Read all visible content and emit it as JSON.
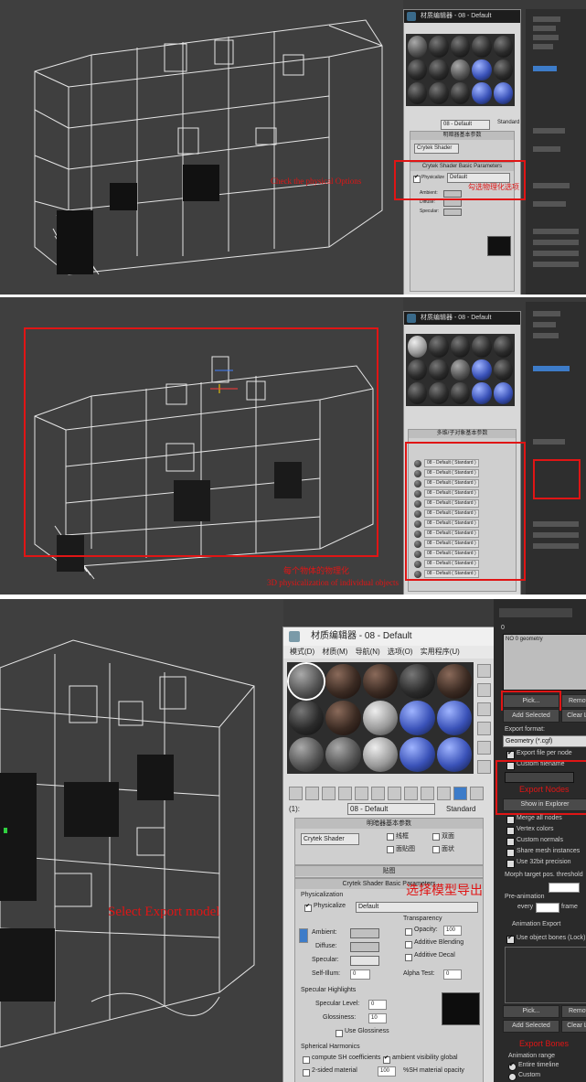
{
  "panel1": {
    "editor_title": "材质编辑器 - 08 - Default",
    "material_slot": "08 - Default",
    "shader_type": "Standard",
    "shader": "Crytek Shader",
    "rollout_basic": "明暗器基本参数",
    "rollout_crytek": "Crytek Shader Basic Parameters",
    "physicalize_label": "Physicalize",
    "physicalize_value": "Default",
    "ambient_label": "Ambient:",
    "diffuse_label": "Diffuse:",
    "specular_label": "Specular:",
    "annotation_en": "Check the physical Options",
    "annotation_cn": "勾选物理化选项"
  },
  "panel2": {
    "editor_title": "材质编辑器 - 08 - Default",
    "multi_header": "多维/子对象基本参数",
    "list_count": 12,
    "list_item_label": "08 - Default ( Standard )",
    "annotation_cn": "每个物体的物理化",
    "annotation_en": "3D physicalization of individual objects"
  },
  "panel3": {
    "editor_title": "材质编辑器 - 08 - Default",
    "menu": [
      "模式(D)",
      "材质(M)",
      "导航(N)",
      "选项(O)",
      "实用程序(U)"
    ],
    "slot_number": "(1):",
    "material_slot": "08 - Default",
    "shader_type": "Standard",
    "rollout_basic": "明暗器基本参数",
    "shader": "Crytek Shader",
    "checks": [
      "线框",
      "双面",
      "面贴图",
      "面状"
    ],
    "rollout_maps": "贴图",
    "rollout_crytek": "Crytek Shader Basic Parameters",
    "physicalization_group": "Physicalization",
    "physicalize_label": "Physicalize",
    "physicalize_value": "Default",
    "ambient_label": "Ambient:",
    "diffuse_label": "Diffuse:",
    "specular_label": "Specular:",
    "self_illum_label": "Self-Illum:",
    "self_illum_value": "0",
    "transparency_group": "Transparency",
    "opacity_label": "Opacity:",
    "opacity_value": "100",
    "additive_blending": "Additive Blending",
    "additive_decal": "Additive Decal",
    "alpha_test_label": "Alpha Test:",
    "alpha_test_value": "0",
    "specular_group": "Specular Highlights",
    "spec_level_label": "Specular Level:",
    "spec_level_value": "0",
    "glossiness_label": "Glossiness:",
    "glossiness_value": "10",
    "use_glossiness": "Use Glossiness",
    "sh_group": "Spherical Harmonics",
    "compute_sh": "compute SH coefficients",
    "ambient_visibility": "ambient visibility global",
    "two_sided": "2-sided material",
    "sh_opacity_value": "100",
    "sh_opacity_label": "%SH material opacity",
    "annotation_en": "Select Export model",
    "annotation_cn": "选择模型导出"
  },
  "exporter": {
    "panel_title": "0",
    "list_item": "NO 0 geometry",
    "pick": "Pick...",
    "remove": "Remove",
    "add_selected": "Add Selected",
    "clear_list": "Clear List",
    "export_format_label": "Export format:",
    "export_format_value": "Geometry (*.cgf)",
    "export_file_per_node": "Export file per node",
    "custom_filename": "Custom filename",
    "export_nodes_label": "Export Nodes",
    "show_in_explorer": "Show in Explorer",
    "merge_all_nodes": "Merge all nodes",
    "vertex_colors": "Vertex colors",
    "custom_normals": "Custom normals",
    "share_mesh_instances": "Share mesh instances",
    "use_32bit": "Use 32bit precision",
    "morph_threshold": "Morph target pos. threshold",
    "pre_animation": "Pre-animation",
    "every_label": "every",
    "frame_label": "frame",
    "animation_export": "Animation Export",
    "use_object_bones": "Use object bones (Lock)",
    "pick2": "Pick...",
    "remove2": "Remove",
    "add_selected2": "Add Selected",
    "clear_list2": "Clear List",
    "export_bones_label": "Export Bones",
    "animation_range": "Animation range",
    "entire_timeline": "Entire timeline",
    "custom": "Custom"
  },
  "colors": {
    "viewport_bg": "#3f3f3f",
    "annotation_red": "#e01515",
    "ui_gray": "#d8d8d8",
    "command_panel": "#2a2a2a"
  }
}
